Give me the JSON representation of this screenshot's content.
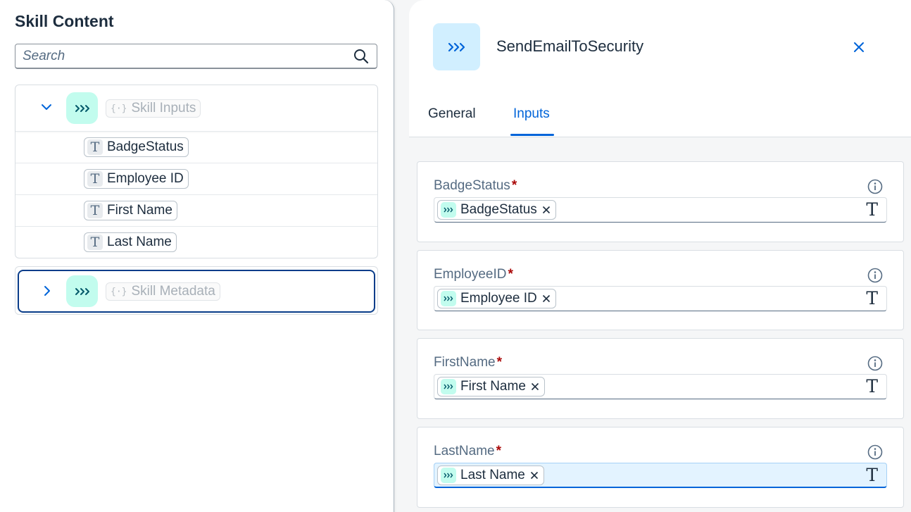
{
  "left": {
    "title": "Skill Content",
    "search": {
      "placeholder": "Search",
      "value": ""
    },
    "groups": [
      {
        "label": "Skill Inputs",
        "expanded": true,
        "items": [
          "BadgeStatus",
          "Employee ID",
          "First Name",
          "Last Name"
        ]
      },
      {
        "label": "Skill Metadata",
        "expanded": false,
        "focused": true,
        "items": []
      }
    ]
  },
  "right": {
    "title": "SendEmailToSecurity",
    "tabs": [
      {
        "label": "General",
        "selected": false
      },
      {
        "label": "Inputs",
        "selected": true
      }
    ],
    "fields": [
      {
        "label": "BadgeStatus",
        "required": "*",
        "token": "BadgeStatus",
        "active": false
      },
      {
        "label": "EmployeeID",
        "required": "*",
        "token": "Employee ID",
        "active": false
      },
      {
        "label": "FirstName",
        "required": "*",
        "token": "First Name",
        "active": false
      },
      {
        "label": "LastName",
        "required": "*",
        "token": "Last Name",
        "active": true
      }
    ],
    "type_glyph": "T"
  },
  "colors": {
    "accent": "#0064d9",
    "node_bg": "#c2fcee",
    "header_icon_bg": "#d1efff",
    "required": "#aa0808",
    "focus_border": "#0a3d8a"
  },
  "icons": {
    "search": "search-icon",
    "chevron_down": "chevron-down-icon",
    "chevron_right": "chevron-right-icon",
    "flow": "triple-chevron-icon",
    "braces": "braces-icon",
    "text_type": "text-type-icon",
    "close": "close-icon",
    "info": "info-icon",
    "remove": "remove-token-icon"
  }
}
